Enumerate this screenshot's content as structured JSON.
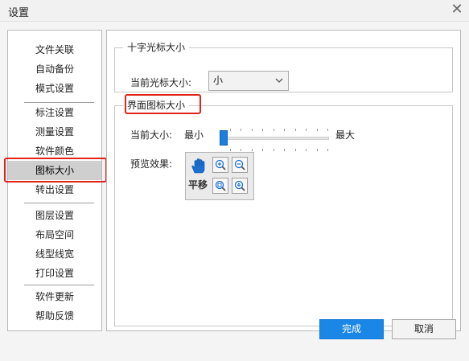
{
  "dialog": {
    "title": "设置"
  },
  "sidebar": {
    "groups": [
      [
        "文件关联",
        "自动备份",
        "模式设置"
      ],
      [
        "标注设置",
        "测量设置",
        "软件颜色",
        "图标大小",
        "转出设置"
      ],
      [
        "图层设置",
        "布局空间",
        "线型线宽",
        "打印设置"
      ],
      [
        "软件更新",
        "帮助反馈"
      ]
    ],
    "selected": "图标大小"
  },
  "crosshair_section": {
    "legend": "十字光标大小",
    "label": "当前光标大小:",
    "value": "小"
  },
  "icon_size_section": {
    "legend": "界面图标大小",
    "current_label": "当前大小:",
    "min_label": "最小",
    "max_label": "最大",
    "slider_value": 0,
    "preview_label": "预览效果:",
    "pan_label": "平移",
    "preview_icons": [
      "hand-icon",
      "zoom-in-icon",
      "zoom-out-icon",
      "zoom-window-icon",
      "zoom-realtime-icon"
    ]
  },
  "footer": {
    "ok": "完成",
    "cancel": "取消"
  },
  "colors": {
    "accent": "#1a86e6",
    "highlight": "#e2231a",
    "selected_bg": "#cfcfcf"
  }
}
